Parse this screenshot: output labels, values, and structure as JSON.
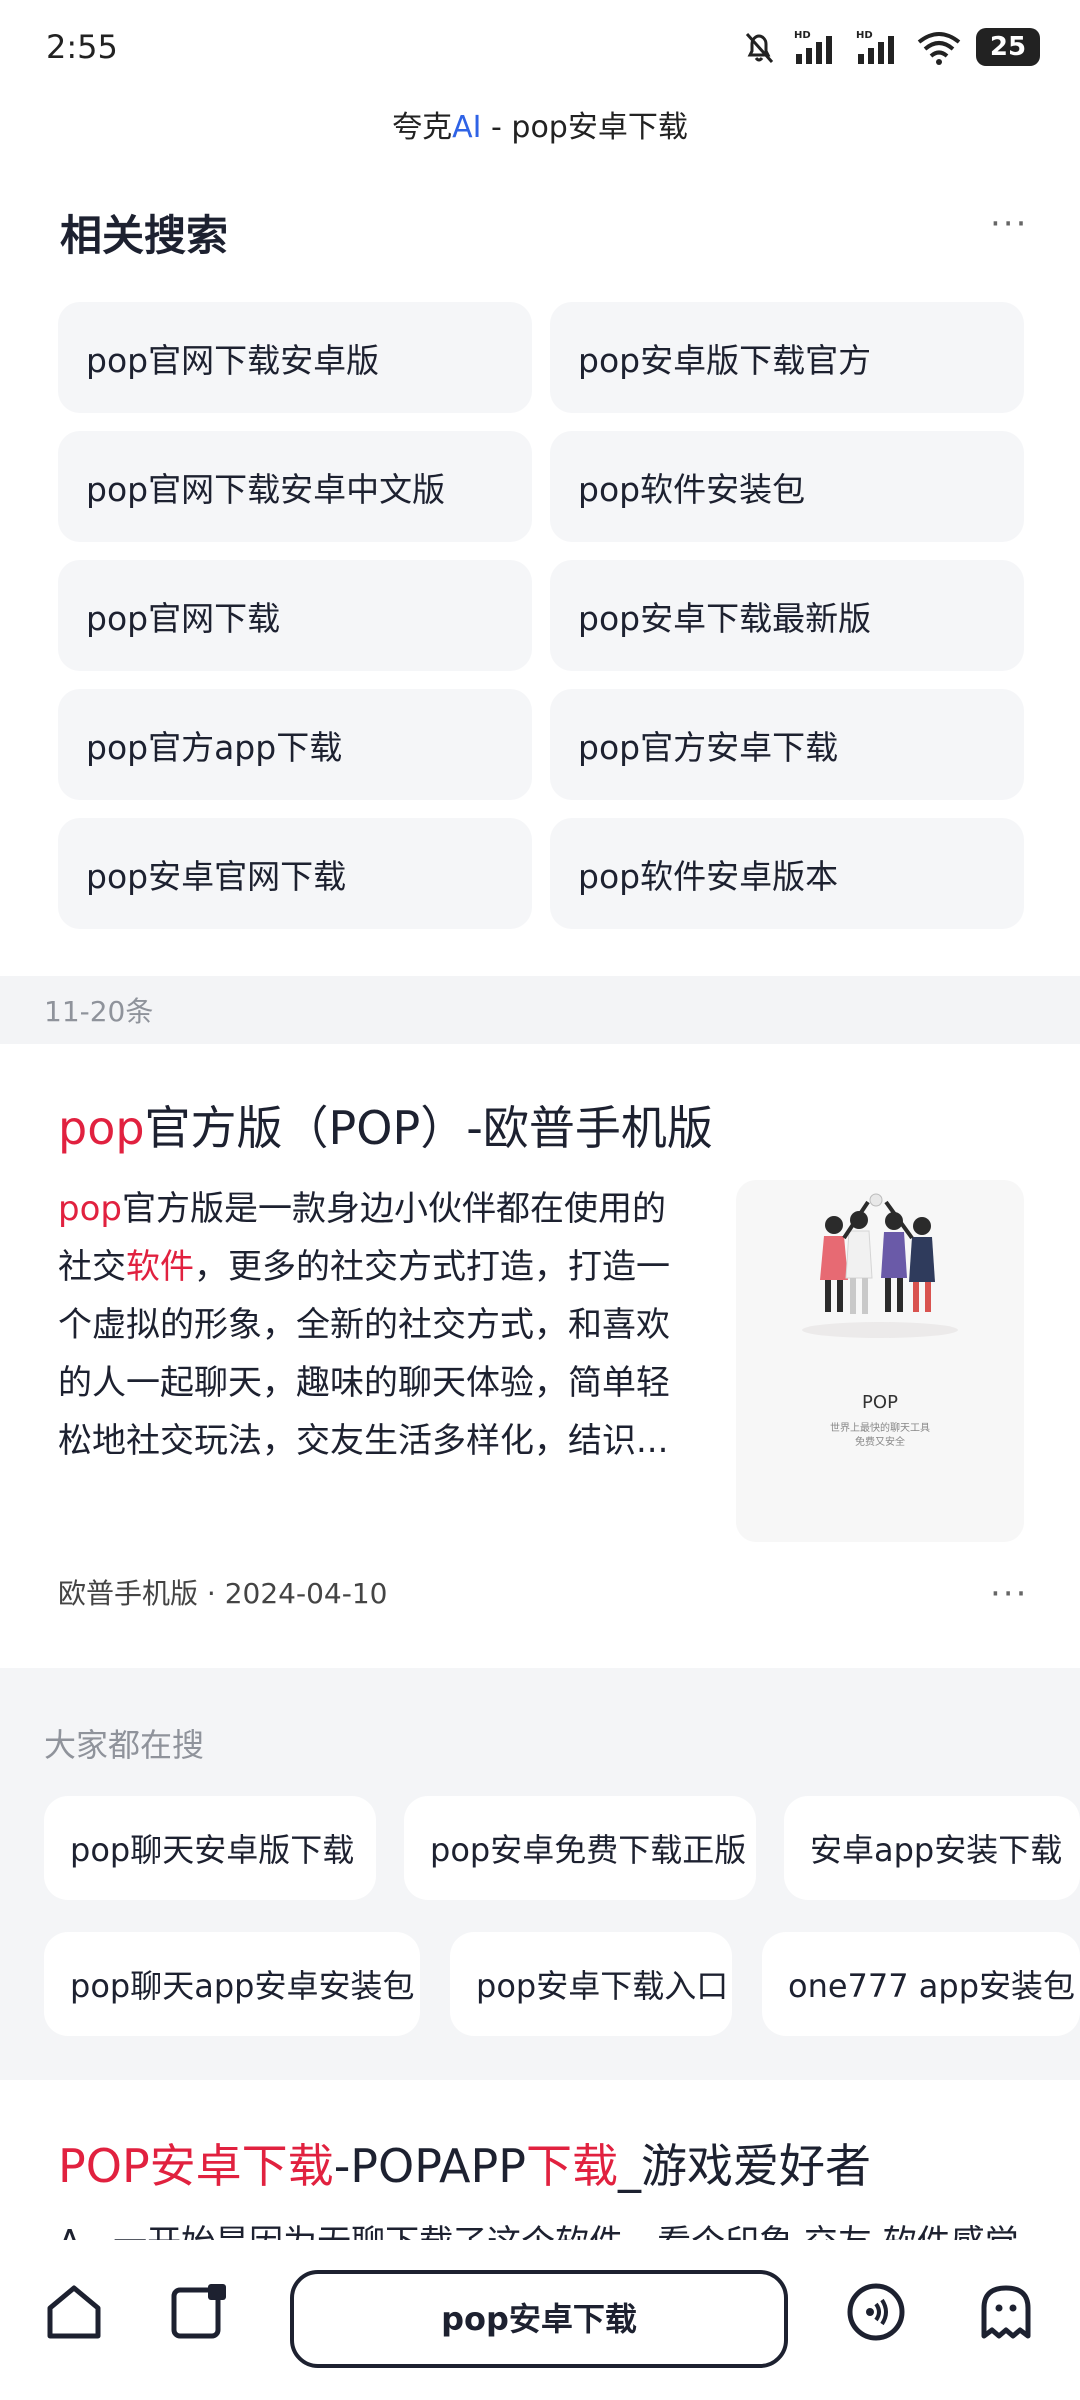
{
  "status_bar": {
    "time": "2:55",
    "battery": "25",
    "icons": [
      "mute-bell-icon",
      "hd-signal-icon",
      "hd-signal-icon",
      "wifi-icon",
      "battery-icon"
    ]
  },
  "header": {
    "title_prefix": "夸克",
    "title_accent": "AI",
    "title_suffix": " - pop安卓下载",
    "accent_color": "#2f63e6"
  },
  "related_search": {
    "title": "相关搜索",
    "more": "···",
    "items": [
      "pop官网下载安卓版",
      "pop安卓版下载官方",
      "pop官网下载安卓中文版",
      "pop软件安装包",
      "pop官网下载",
      "pop安卓下载最新版",
      "pop官方app下载",
      "pop官方安卓下载",
      "pop安卓官网下载",
      "pop软件安卓版本"
    ]
  },
  "pagination": {
    "label": "11-20条"
  },
  "result1": {
    "title_red": "pop",
    "title_rest": "官方版（POP）-欧普手机版",
    "snippet_red1": "pop",
    "snippet_part1": "官方版是一款身边小伙伴都在使用的社交",
    "snippet_red2": "软件",
    "snippet_part2": "，更多的社交方式打造，打造一个虚拟的形象，全新的社交方式，和喜欢的人一起聊天，趣味的聊天体验，简单轻松地社交玩法，交友生活多样化，结识...",
    "thumb_label": "POP",
    "thumb_sub1": "世界上最快的聊天工具",
    "thumb_sub2": "免费又安全",
    "source": "欧普手机版",
    "date": "2024-04-10",
    "more": "···",
    "highlight_color": "#e1213f"
  },
  "popular": {
    "title": "大家都在搜",
    "row1": [
      "pop聊天安卓版下载",
      "pop安卓免费下载正版",
      "安卓app安装下载"
    ],
    "row2": [
      "pop聊天app安卓安装包",
      "pop安卓下载入口",
      "one777 app安装包"
    ]
  },
  "result2": {
    "title_red": "POP安卓下载",
    "title_mid": "-POPAPP",
    "title_red2": "下载",
    "title_rest": "_游戏爱好者",
    "snippet": "A...一开始是因为无聊下载了这个软件，看个印象 交友 软件感觉"
  },
  "bottom_bar": {
    "search_text": "pop安卓下载",
    "icons": [
      "home-icon",
      "tabs-icon",
      "voice-icon",
      "ghost-icon"
    ]
  }
}
